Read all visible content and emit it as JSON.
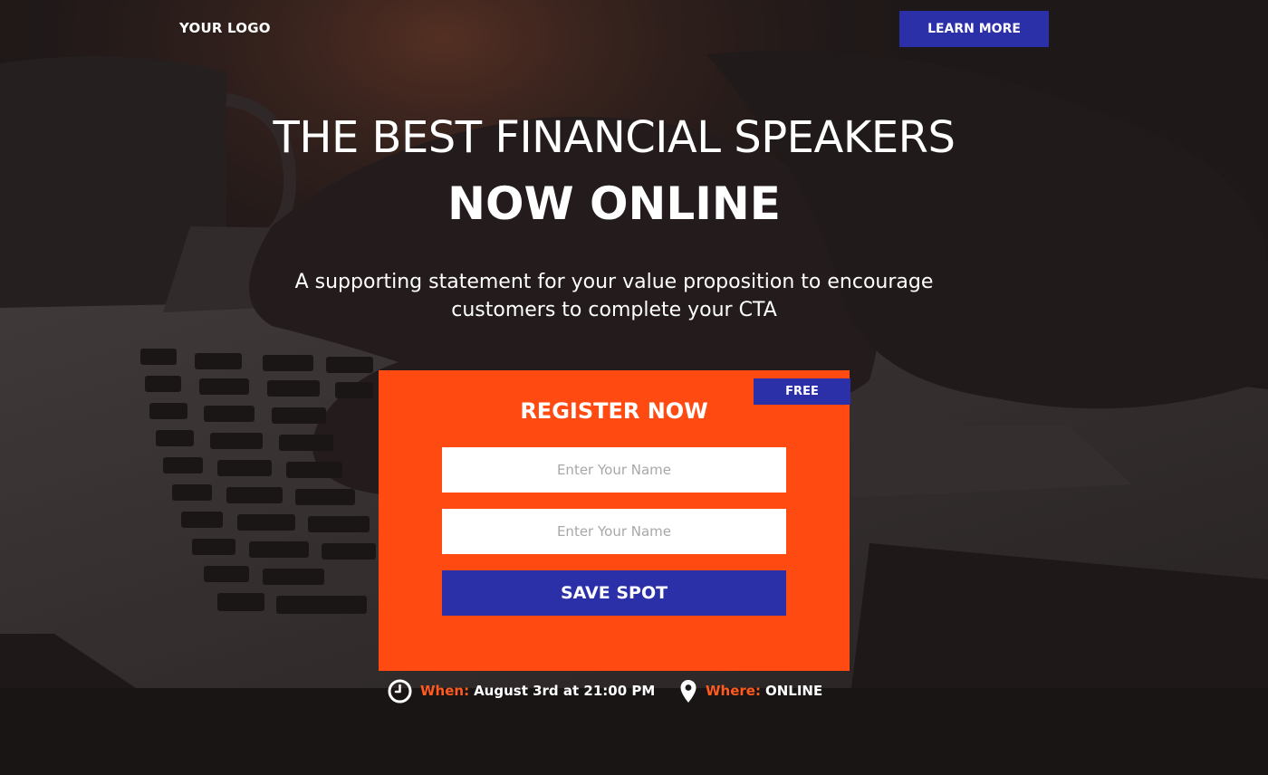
{
  "header": {
    "logo_text": "YOUR LOGO",
    "learn_more_label": "LEARN MORE"
  },
  "hero": {
    "title_line1": "THE BEST FINANCIAL SPEAKERS",
    "title_line2": "NOW ONLINE",
    "subtitle": "A supporting statement for your value proposition to encourage customers to complete your CTA"
  },
  "form": {
    "badge": "FREE",
    "title": "REGISTER NOW",
    "fields": [
      {
        "placeholder": "Enter Your Name",
        "value": ""
      },
      {
        "placeholder": "Enter Your Name",
        "value": ""
      }
    ],
    "submit_label": "SAVE SPOT"
  },
  "event": {
    "when_label": "When:",
    "when_value": "August 3rd at 21:00 PM",
    "when_icon": "clock-icon",
    "where_label": "Where:",
    "where_value": "ONLINE",
    "where_icon": "map-pin-icon"
  },
  "colors": {
    "accent_orange": "#ff4b12",
    "accent_blue": "#2b2fa8",
    "background_dark": "#1e1a1a"
  }
}
